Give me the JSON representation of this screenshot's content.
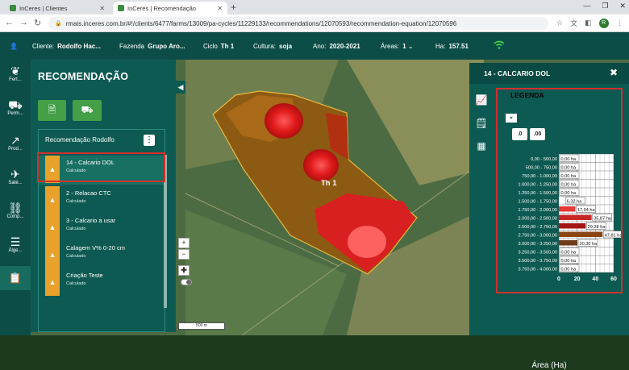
{
  "browser": {
    "tabs": [
      {
        "title": "InCeres | Clientes"
      },
      {
        "title": "InCeres | Recomendação"
      }
    ],
    "new_tab": "+",
    "url": "rmais.inceres.com.br/#!/clients/6477/farms/13009/pa-cycles/11229133/recommendations/12070593/recommendation-equation/12070596",
    "profile_initial": "R"
  },
  "appbar": {
    "cliente_label": "Cliente:",
    "cliente_value": "Rodolfo Hac...",
    "fazenda_label": "Fazenda",
    "fazenda_value": "Grupo Aro...",
    "ciclo_label": "Ciclo",
    "ciclo_value": "Th 1",
    "cultura_label": "Cultura:",
    "cultura_value": "soja",
    "ano_label": "Ano:",
    "ano_value": "2020-2021",
    "areas_label": "Áreas:",
    "areas_value": "1",
    "ha_label": "Ha:",
    "ha_value": "157.51"
  },
  "leftnav": {
    "items": [
      {
        "label": "Fert...",
        "icon": "fertilizer-icon"
      },
      {
        "label": "Perm...",
        "icon": "tractor-icon"
      },
      {
        "label": "Prod...",
        "icon": "chart-line-icon"
      },
      {
        "label": "Saté...",
        "icon": "satellite-icon"
      },
      {
        "label": "Comp...",
        "icon": "compare-icon"
      },
      {
        "label": "Álge...",
        "icon": "layers-icon"
      },
      {
        "label": "",
        "icon": "clipboard-icon"
      }
    ]
  },
  "recommendation": {
    "title": "RECOMENDAÇÃO",
    "list_title": "Recomendação Rodolfo",
    "items": [
      {
        "name": "14 - Calcario DOL",
        "status": "Calculado"
      },
      {
        "name": "2 - Relacao CTC",
        "status": "Calculado"
      },
      {
        "name": "3 - Calcario a usar",
        "status": "Calculado"
      },
      {
        "name": "Calagem V% 0-20 cm",
        "status": "Calculado"
      },
      {
        "name": "Criação Teste",
        "status": "Calculado"
      }
    ]
  },
  "map": {
    "field_label": "Th 1",
    "zoom_in": "+",
    "zoom_out": "−",
    "scale_label": "500 m"
  },
  "rightpanel": {
    "title": "14 - CALCARIO DOL",
    "legend_title": "LEGENDA",
    "back_label": "«",
    "decimal_buttons": [
      ".0",
      ".00"
    ],
    "area_title": "Área (Ha)"
  },
  "colors": {
    "header_bg": "#0c4d48",
    "panel_bg": "#0d5a52",
    "accent_green": "#43a047",
    "warning": "#e8a12a",
    "highlight_red": "#d32f2f"
  },
  "chart_data": {
    "type": "bar",
    "orientation": "horizontal",
    "categories": [
      "0,00 - 500,00",
      "500,00 - 750,00",
      "750,00 - 1.000,00",
      "1.000,00 - 1.250,00",
      "1.250,00 - 1.500,00",
      "1.500,00 - 1.750,00",
      "1.750,00 - 2.000,00",
      "2.000,00 - 2.500,00",
      "2.500,00 - 2.750,00",
      "2.750,00 - 3.000,00",
      "3.000,00 - 3.250,00",
      "3.250,00 - 3.500,00",
      "3.500,00 - 3.750,00",
      "3.750,00 - 4.000,00"
    ],
    "values": [
      0,
      0,
      0,
      0,
      0,
      6.32,
      17.94,
      35.87,
      29.28,
      47.81,
      20.3,
      0,
      0,
      0
    ],
    "value_labels": [
      "0,00 ha",
      "0,00 ha",
      "0,00 ha",
      "0,00 ha",
      "0,00 ha",
      "6,32 ha",
      "17,94 ha",
      "35,87 ha",
      "29,28 ha",
      "47,81 ha",
      "20,30 ha",
      "0,00 ha",
      "0,00 ha",
      "0,00 ha"
    ],
    "colors": [
      "#ffffff",
      "#ffffff",
      "#ffffff",
      "#ffffff",
      "#ffffff",
      "#ffffff",
      "#e53935",
      "#c62828",
      "#a31515",
      "#8b4513",
      "#6d3b1a",
      "#ffffff",
      "#ffffff",
      "#ffffff"
    ],
    "xlabel": "Área (Ha)",
    "xticks": [
      0,
      20,
      40,
      60
    ],
    "xlim": [
      0,
      60
    ],
    "grid": true
  }
}
